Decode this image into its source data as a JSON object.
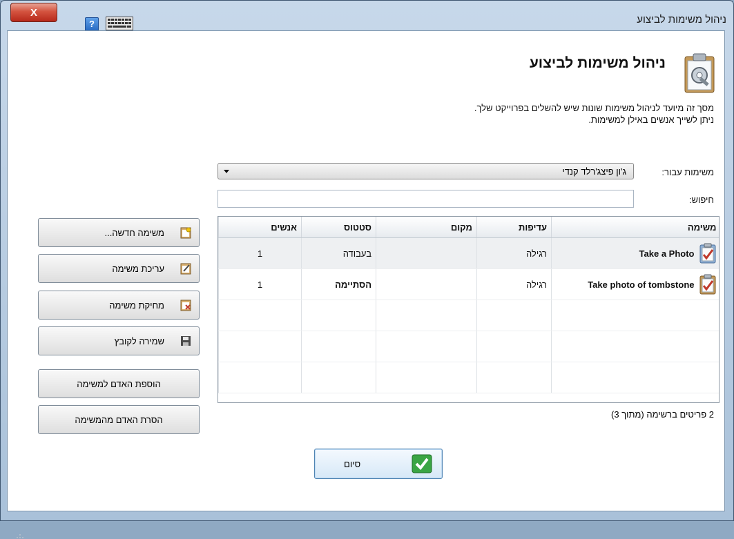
{
  "window": {
    "title": "ניהול משימות לביצוע",
    "close_label": "X",
    "help_label": "?"
  },
  "header": {
    "title": "ניהול משימות לביצוע",
    "description_line1": "מסך זה מיועד לניהול משימות שונות שיש להשלים בפרוייקט שלך.",
    "description_line2": "ניתן לשייך אנשים באילן למשימות."
  },
  "filters": {
    "tasks_for_label": "משימות עבור:",
    "tasks_for_value": "ג'ון פיצג'רלד קנדי",
    "search_label": "חיפוש:",
    "search_value": ""
  },
  "grid": {
    "columns": [
      "משימה",
      "עדיפות",
      "מקום",
      "סטטוס",
      "אנשים"
    ],
    "rows": [
      {
        "task": "Take a Photo",
        "priority": "רגילה",
        "place": "",
        "status": "בעבודה",
        "people": "1",
        "status_color": "#111111"
      },
      {
        "task": "Take photo of tombstone",
        "priority": "רגילה",
        "place": "",
        "status": "הסתיימה",
        "people": "1",
        "status_color": "#1e8a2a"
      }
    ],
    "count_label": "2 פריטים ברשימה (מתוך 3)"
  },
  "side_buttons": {
    "new_task": "משימה חדשה...",
    "edit_task": "עריכת משימה",
    "delete_task": "מחיקת משימה",
    "save_to_file": "שמירה לקובץ",
    "add_person": "הוספת האדם למשימה",
    "remove_person": "הסרת האדם מהמשימה"
  },
  "footer": {
    "finish_label": "סיום"
  }
}
